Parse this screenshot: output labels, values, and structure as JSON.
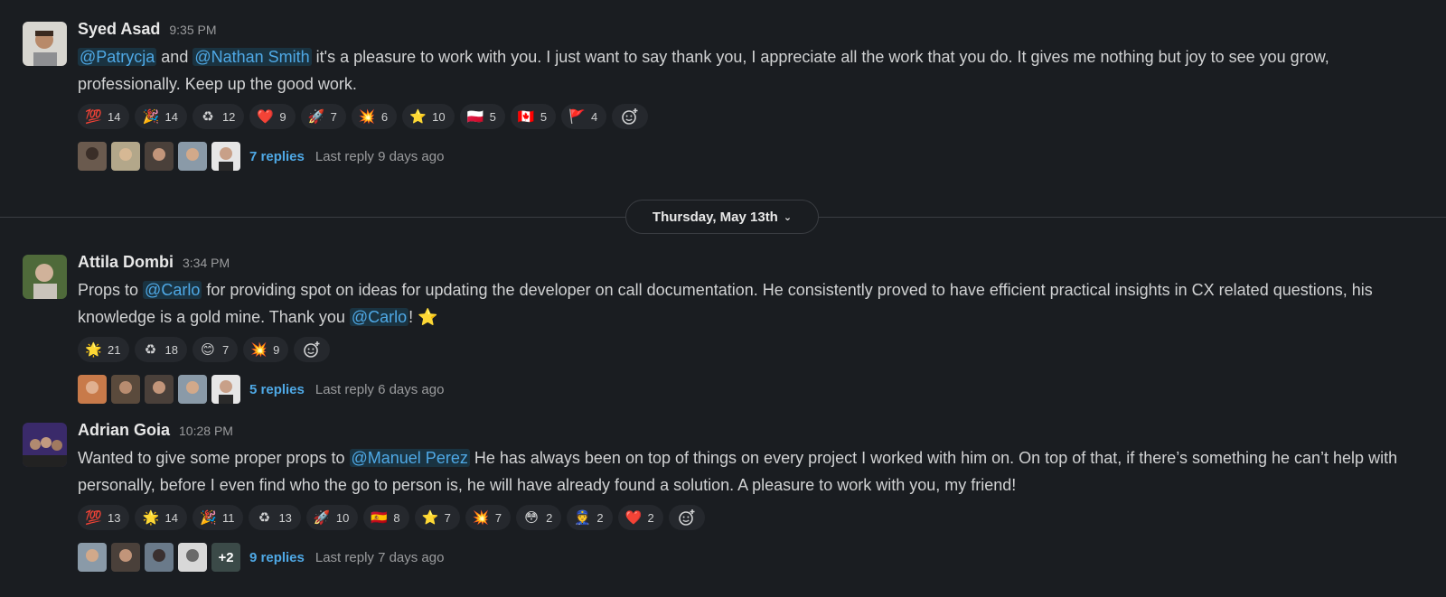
{
  "messages": [
    {
      "author": "Syed Asad",
      "time": "9:35 PM",
      "text_parts": [
        {
          "t": "@Patrycja",
          "mention": true
        },
        {
          "t": " and ",
          "mention": false
        },
        {
          "t": "@Nathan Smith",
          "mention": true
        },
        {
          "t": " it's a pleasure to work with you. I just want to say thank you, I appreciate all the work that you do. It gives me nothing but joy to see you grow, professionally. Keep up the good work.",
          "mention": false
        }
      ],
      "reactions": [
        {
          "emoji": "💯",
          "count": "14"
        },
        {
          "emoji": "🎉",
          "count": "14"
        },
        {
          "emoji": "♻",
          "count": "12"
        },
        {
          "emoji": "❤️",
          "count": "9"
        },
        {
          "emoji": "🚀",
          "count": "7"
        },
        {
          "emoji": "💥",
          "count": "6"
        },
        {
          "emoji": "⭐",
          "count": "10"
        },
        {
          "emoji": "🇵🇱",
          "count": "5"
        },
        {
          "emoji": "🇨🇦",
          "count": "5"
        },
        {
          "emoji": "🚩",
          "count": "4"
        }
      ],
      "reply_count": "7 replies",
      "last_reply": "Last reply 9 days ago"
    },
    {
      "author": "Attila Dombi",
      "time": "3:34 PM",
      "text_parts": [
        {
          "t": "Props to ",
          "mention": false
        },
        {
          "t": "@Carlo",
          "mention": true
        },
        {
          "t": " for providing spot on ideas for updating the developer on call documentation. He consistently proved to have efficient practical insights in CX related questions, his knowledge is a gold mine. Thank you ",
          "mention": false
        },
        {
          "t": "@Carlo",
          "mention": true
        },
        {
          "t": "! ⭐",
          "mention": false
        }
      ],
      "reactions": [
        {
          "emoji": "🌟",
          "count": "21"
        },
        {
          "emoji": "♻",
          "count": "18"
        },
        {
          "emoji": "😊",
          "count": "7"
        },
        {
          "emoji": "💥",
          "count": "9"
        }
      ],
      "reply_count": "5 replies",
      "last_reply": "Last reply 6 days ago"
    },
    {
      "author": "Adrian Goia",
      "time": "10:28 PM",
      "text_parts": [
        {
          "t": "Wanted to give some proper props to ",
          "mention": false
        },
        {
          "t": "@Manuel Perez",
          "mention": true
        },
        {
          "t": " He has always been on top of things on every project I worked with him on. On top of that, if there’s something he can’t help with personally, before I even find who the go to person is, he will have already found a solution. A pleasure to work with you, my friend!",
          "mention": false
        }
      ],
      "reactions": [
        {
          "emoji": "💯",
          "count": "13"
        },
        {
          "emoji": "🌟",
          "count": "14"
        },
        {
          "emoji": "🎉",
          "count": "11"
        },
        {
          "emoji": "♻",
          "count": "13"
        },
        {
          "emoji": "🚀",
          "count": "10"
        },
        {
          "emoji": "🇪🇸",
          "count": "8"
        },
        {
          "emoji": "⭐",
          "count": "7"
        },
        {
          "emoji": "💥",
          "count": "7"
        },
        {
          "emoji": "😳",
          "count": "2"
        },
        {
          "emoji": "👮",
          "count": "2"
        },
        {
          "emoji": "❤️",
          "count": "2"
        }
      ],
      "reply_more": "+2",
      "reply_count": "9 replies",
      "last_reply": "Last reply 7 days ago"
    }
  ],
  "date_divider": {
    "label": "Thursday, May 13th"
  },
  "colors": {
    "mention": "#4fa9e6",
    "background": "#1a1d21"
  }
}
